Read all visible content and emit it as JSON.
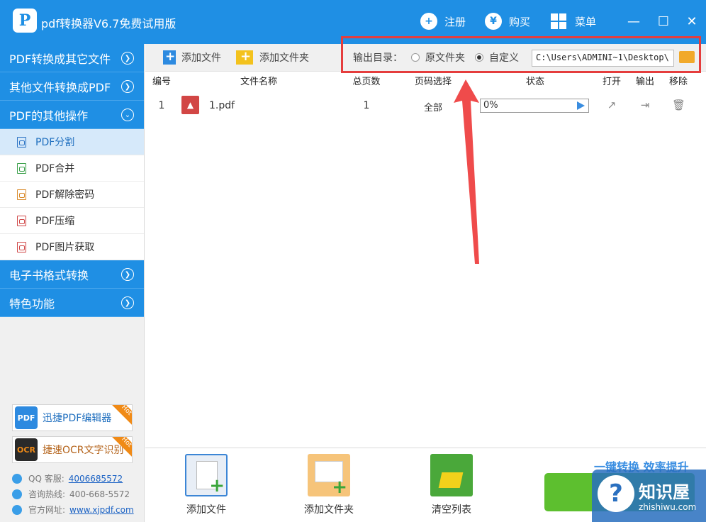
{
  "title": "pdf转换器V6.7免费试用版",
  "header": {
    "register": "注册",
    "buy": "购买",
    "menu": "菜单",
    "buy_symbol": "¥",
    "minimize": "—",
    "maximize": "☐",
    "close": "✕"
  },
  "sidebar": {
    "categories": [
      {
        "label": "PDF转换成其它文件"
      },
      {
        "label": "其他文件转换成PDF"
      },
      {
        "label": "PDF的其他操作"
      },
      {
        "label": "电子书格式转换"
      },
      {
        "label": "特色功能"
      }
    ],
    "sub_items": [
      {
        "label": "PDF分割"
      },
      {
        "label": "PDF合并"
      },
      {
        "label": "PDF解除密码"
      },
      {
        "label": "PDF压缩"
      },
      {
        "label": "PDF图片获取"
      }
    ],
    "promos": [
      {
        "label": "迅捷PDF编辑器",
        "badge": "Hot",
        "icon_text": "PDF"
      },
      {
        "label": "捷速OCR文字识别",
        "badge": "Hot",
        "icon_text": "OCR"
      }
    ],
    "contact": {
      "qq_label": "QQ 客服:",
      "qq_value": "4006685572",
      "hotline_label": "咨询热线:",
      "hotline_value": "400-668-5572",
      "site_label": "官方网址:",
      "site_value": "www.xjpdf.com"
    }
  },
  "toolbar": {
    "add_file": "添加文件",
    "add_folder": "添加文件夹",
    "output_label": "输出目录：",
    "radio_original": "原文件夹",
    "radio_custom": "自定义",
    "output_path": "C:\\Users\\ADMINI~1\\Desktop\\"
  },
  "table": {
    "headers": [
      "编号",
      "文件名称",
      "总页数",
      "页码选择",
      "状态",
      "打开",
      "输出",
      "移除"
    ],
    "rows": [
      {
        "num": "1",
        "filename": "1.pdf",
        "pages": "1",
        "page_select": "全部",
        "progress": "0%",
        "progress_fraction": 0
      }
    ]
  },
  "bottom": {
    "add_file": "添加文件",
    "add_folder": "添加文件夹",
    "clear_list": "清空列表",
    "slogan": "一键转换  效率提升"
  },
  "watermark": {
    "title": "知识屋",
    "url": "zhishiwu.com"
  },
  "colors": {
    "brand_blue": "#1f8fe4",
    "highlight_red": "#e53d3d",
    "convert_green": "#5dbf2f"
  }
}
